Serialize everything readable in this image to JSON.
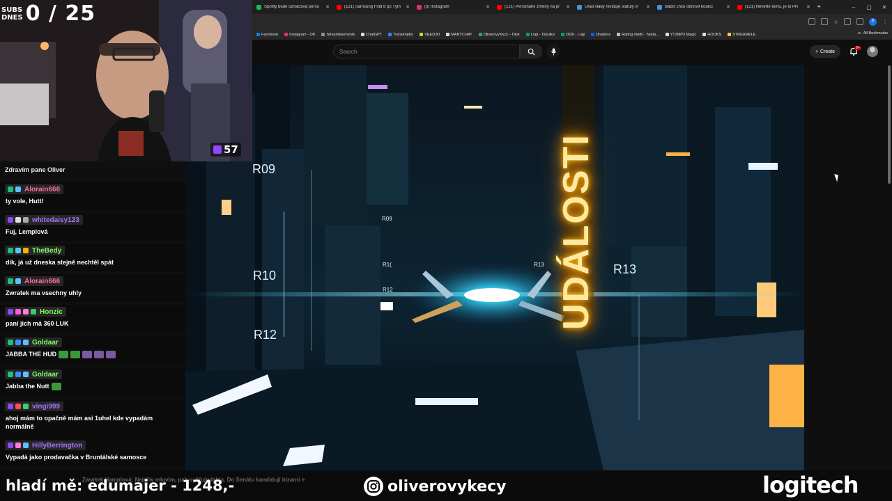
{
  "browser": {
    "tabs": [
      {
        "title": "Spotify bude označovat perso",
        "color": "#1db954"
      },
      {
        "title": "(121) Samsung Fold 8 po Tým",
        "color": "#ff0000"
      },
      {
        "title": "(3) Instagram",
        "color": "#e1306c"
      },
      {
        "title": "(121) Personální změny na pr",
        "color": "#ff0000"
      },
      {
        "title": "Úřad vlády reviduje statuty vl",
        "color": "#4a90e2"
      },
      {
        "title": "Babiš chce obnovit koalici",
        "color": "#4a90e2"
      },
      {
        "title": "(121) Nevěřte tomu, je to PR",
        "color": "#ff0000"
      }
    ],
    "new_tab": "+",
    "bookmarks": [
      {
        "label": "Facebook",
        "color": "#1877f2"
      },
      {
        "label": "Instagram - OK",
        "color": "#e1306c"
      },
      {
        "label": "StreamElements",
        "color": "#8f8f8f"
      },
      {
        "label": "ChatGPT",
        "color": "#dddddd"
      },
      {
        "label": "Transkriptor",
        "color": "#3b82f6"
      },
      {
        "label": "VEEDJO",
        "color": "#b5e61d"
      },
      {
        "label": "MANYCHAT",
        "color": "#dddddd"
      },
      {
        "label": "OliverovyKecy – Disk",
        "color": "#34a853"
      },
      {
        "label": "Logi - Tabulka",
        "color": "#0f9d58"
      },
      {
        "label": "2026 - Logi",
        "color": "#0f9d58"
      },
      {
        "label": "Dropbox",
        "color": "#0061ff"
      },
      {
        "label": "Rating médií - Nada...",
        "color": "#bbbbbb"
      },
      {
        "label": "YT2MP3 Magic",
        "color": "#dddddd"
      },
      {
        "label": "HOOKS",
        "color": "#dddddd"
      },
      {
        "label": "STREAMELE",
        "color": "#f2c94c"
      }
    ],
    "all_bookmarks": "All Bookmarks",
    "profile_letter": "P"
  },
  "youtube": {
    "search_placeholder": "Search",
    "create_label": "Create",
    "notification_count": "9+"
  },
  "video": {
    "headline_word": "UDÁLOSTI",
    "labels_big": [
      "R09",
      "R10",
      "R12",
      "R13"
    ],
    "labels_small": [
      "R09",
      "R1(",
      "R13",
      "R12"
    ]
  },
  "stream": {
    "subs_label_1": "SUBS",
    "subs_label_2": "DNES",
    "subs_count": "0 / 25",
    "viewer_count": "57"
  },
  "chat": {
    "partial_line": "Zdravím pane Oliver",
    "messages": [
      {
        "user": "Alorain666",
        "color": "#ff6b9a",
        "badges": [
          "#19c37d",
          "#5dc1ff"
        ],
        "text": "ty vole, Hutt!"
      },
      {
        "user": "whitedaisy123",
        "color": "#a970ff",
        "badges": [
          "#9146ff",
          "#e0e0e0",
          "#aaaaaa"
        ],
        "text": "Fuj, Lemplová"
      },
      {
        "user": "TheBedy",
        "color": "#7cff5c",
        "badges": [
          "#19c37d",
          "#5dc1ff",
          "#ffb000"
        ],
        "text": "dík, já už dneska stejně nechtěl spát"
      },
      {
        "user": "Alorain666",
        "color": "#ff6b9a",
        "badges": [
          "#19c37d",
          "#5dc1ff"
        ],
        "text": "Zwratek ma vsechny uhly"
      },
      {
        "user": "Honzic",
        "color": "#7cff5c",
        "badges": [
          "#9146ff",
          "#ff5ce1",
          "#ff7ad9",
          "#42c86a"
        ],
        "text": "paní jich má 360 LUK"
      },
      {
        "user": "Goldaar",
        "color": "#7cff5c",
        "badges": [
          "#19c37d",
          "#3b8bff",
          "#5dc1ff"
        ],
        "text": "JABBA THE HUD"
      },
      {
        "user": "Goldaar",
        "color": "#7cff5c",
        "badges": [
          "#19c37d",
          "#3b8bff",
          "#5dc1ff"
        ],
        "text": "Jabba the Nutt"
      },
      {
        "user": "vingi999",
        "color": "#a970ff",
        "badges": [
          "#9146ff",
          "#ff4f4f",
          "#3bd16f"
        ],
        "text": "ahoj mám to opačně mám asi 1uhel kde vypadám normálně"
      },
      {
        "user": "HillyBerrington",
        "color": "#a970ff",
        "badges": [
          "#9146ff",
          "#ff7ad9",
          "#5dc1ff"
        ],
        "text": "Vypadá jako prodavačka v Bruntálské samosce"
      }
    ]
  },
  "bottom": {
    "ticker_text": "Zwyrtek Hamplová: Nejdřív mluvím, pak ověřuju fakta. Do Senátu kandidují bizarní e",
    "donation_text": "hladí mě: edumajer - 1248,-",
    "instagram_handle": "oliverovykecy",
    "sponsor": "logitech"
  }
}
